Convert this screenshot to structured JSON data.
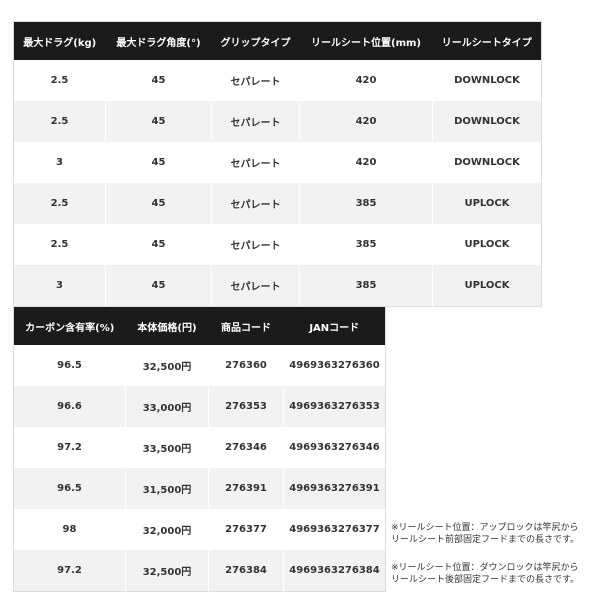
{
  "table1": {
    "headers": [
      "最大ドラグ(kg)",
      "最大ドラグ角度(°)",
      "グリップタイプ",
      "リールシート位置(mm)",
      "リールシートタイプ"
    ],
    "rows": [
      [
        "2.5",
        "45",
        "セパレート",
        "420",
        "DOWNLOCK"
      ],
      [
        "2.5",
        "45",
        "セパレート",
        "420",
        "DOWNLOCK"
      ],
      [
        "3",
        "45",
        "セパレート",
        "420",
        "DOWNLOCK"
      ],
      [
        "2.5",
        "45",
        "セパレート",
        "385",
        "UPLOCK"
      ],
      [
        "2.5",
        "45",
        "セパレート",
        "385",
        "UPLOCK"
      ],
      [
        "3",
        "45",
        "セパレート",
        "385",
        "UPLOCK"
      ]
    ]
  },
  "table2": {
    "headers": [
      "カーボン含有率(%)",
      "本体価格(円)",
      "商品コード",
      "JANコード"
    ],
    "rows": [
      [
        "96.5",
        "32,500円",
        "276360",
        "4969363276360"
      ],
      [
        "96.6",
        "33,000円",
        "276353",
        "4969363276353"
      ],
      [
        "97.2",
        "33,500円",
        "276346",
        "4969363276346"
      ],
      [
        "96.5",
        "31,500円",
        "276391",
        "4969363276391"
      ],
      [
        "98",
        "32,000円",
        "276377",
        "4969363276377"
      ],
      [
        "97.2",
        "32,500円",
        "276384",
        "4969363276384"
      ]
    ]
  },
  "notes": {
    "note1_line1": "※リールシート位置：アップロックは竿尻から",
    "note1_line2": "リールシート前部固定フードまでの長さです。",
    "note2_line1": "※リールシート位置：ダウンロックは竿尻から",
    "note2_line2": "リールシート後部固定フードまでの長さです。"
  }
}
